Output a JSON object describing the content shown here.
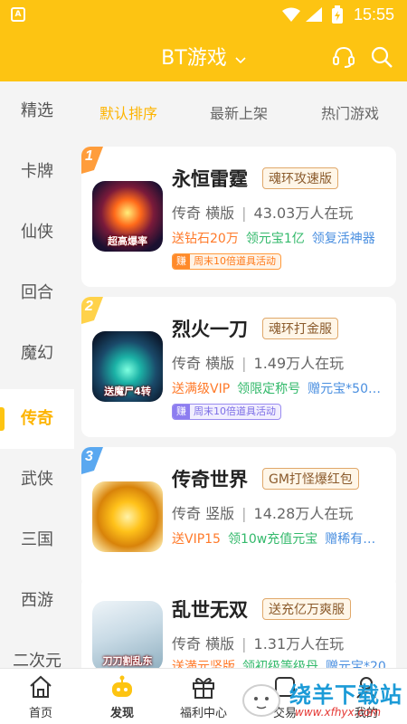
{
  "status_bar": {
    "time": "15:55"
  },
  "header": {
    "title": "BT游戏"
  },
  "sidebar": {
    "items": [
      {
        "label": "精选"
      },
      {
        "label": "卡牌"
      },
      {
        "label": "仙侠"
      },
      {
        "label": "回合"
      },
      {
        "label": "魔幻"
      },
      {
        "label": "传奇",
        "active": true
      },
      {
        "label": "武侠"
      },
      {
        "label": "三国"
      },
      {
        "label": "西游"
      },
      {
        "label": "二次元"
      }
    ]
  },
  "sort_tabs": [
    {
      "label": "默认排序",
      "active": true
    },
    {
      "label": "最新上架"
    },
    {
      "label": "热门游戏"
    }
  ],
  "games": [
    {
      "rank": "1",
      "name": "永恒雷霆",
      "badge": "魂环攻速版",
      "genre": "传奇",
      "orientation": "横版",
      "players": "43.03万人在玩",
      "thumb_caption": "超高爆率",
      "perks": [
        {
          "text": "送钻石20万",
          "color": "orange"
        },
        {
          "text": "领元宝1亿",
          "color": "green"
        },
        {
          "text": "领复活神器",
          "color": "blue"
        }
      ],
      "event": {
        "tag": "赚",
        "text": "周末10倍道具活动",
        "style": "orange"
      }
    },
    {
      "rank": "2",
      "name": "烈火一刀",
      "badge": "魂环打金服",
      "genre": "传奇",
      "orientation": "横版",
      "players": "1.49万人在玩",
      "thumb_caption": "送魔尸4转",
      "perks": [
        {
          "text": "送满级VIP",
          "color": "orange"
        },
        {
          "text": "领限定称号",
          "color": "green"
        },
        {
          "text": "赠元宝*50…",
          "color": "blue"
        }
      ],
      "event": {
        "tag": "赚",
        "text": "周末10倍道具活动",
        "style": "purple"
      }
    },
    {
      "rank": "3",
      "name": "传奇世界",
      "badge": "GM打怪爆红包",
      "genre": "传奇",
      "orientation": "竖版",
      "players": "14.28万人在玩",
      "thumb_caption": "",
      "perks": [
        {
          "text": "送VIP15",
          "color": "orange"
        },
        {
          "text": "领10w充值元宝",
          "color": "green"
        },
        {
          "text": "赠稀有…",
          "color": "blue"
        }
      ],
      "event": null
    },
    {
      "rank": "",
      "name": "乱世无双",
      "badge": "送充亿万爽服",
      "genre": "传奇",
      "orientation": "横版",
      "players": "1.31万人在玩",
      "thumb_caption": "刀刀割乱东",
      "perks": [
        {
          "text": "送満元坚版",
          "color": "orange"
        },
        {
          "text": "领初级等级丹",
          "color": "green"
        },
        {
          "text": "赠元宝*20",
          "color": "blue"
        }
      ],
      "event": null
    }
  ],
  "bottom_nav": [
    {
      "label": "首页"
    },
    {
      "label": "发现",
      "active": true
    },
    {
      "label": "福利中心"
    },
    {
      "label": "交易"
    },
    {
      "label": "我的"
    }
  ],
  "watermark": {
    "text_main": "绕羊下载站",
    "text_url": "www.xfhyx.com"
  },
  "colors": {
    "brand_yellow": "#fdc412",
    "active_text": "#fdb400"
  }
}
